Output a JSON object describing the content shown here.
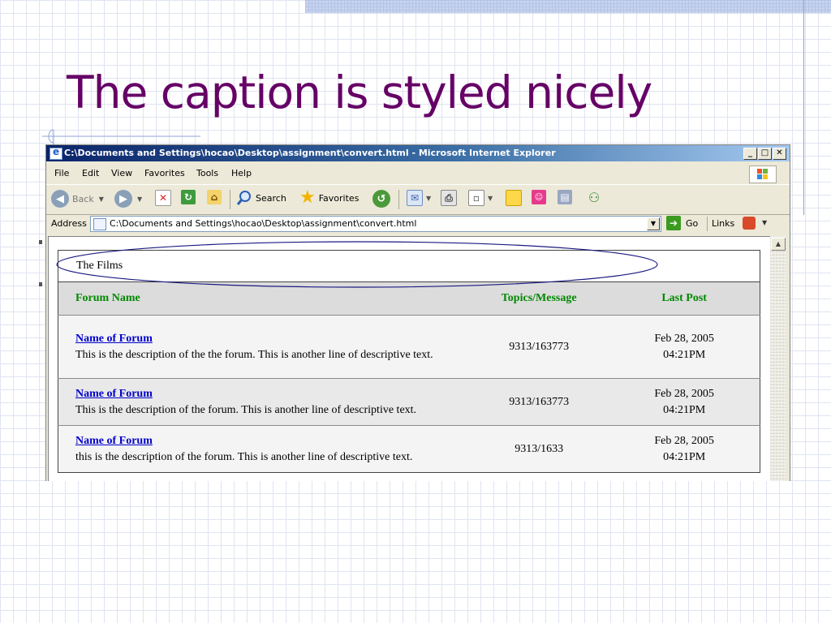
{
  "slide": {
    "title": "The caption is styled nicely"
  },
  "window": {
    "title": "C:\\Documents and Settings\\hocao\\Desktop\\assignment\\convert.html - Microsoft Internet Explorer",
    "min": "_",
    "max": "□",
    "close": "✕"
  },
  "menu": [
    "File",
    "Edit",
    "View",
    "Favorites",
    "Tools",
    "Help"
  ],
  "toolbar": {
    "back": "Back",
    "search": "Search",
    "favorites": "Favorites"
  },
  "address": {
    "label": "Address",
    "value": "C:\\Documents and Settings\\hocao\\Desktop\\assignment\\convert.html",
    "go": "Go",
    "links": "Links"
  },
  "table": {
    "caption": "The Films",
    "headers": [
      "Forum Name",
      "Topics/Message",
      "Last Post"
    ],
    "rows": [
      {
        "name": "Name of Forum",
        "desc": "This is the description of the the forum. This is another line of descriptive text.",
        "topics": "9313/163773",
        "date": "Feb 28, 2005",
        "time": "04:21PM"
      },
      {
        "name": "Name of Forum",
        "desc": "This is the description of the forum. This is another line of descriptive text.",
        "topics": "9313/163773",
        "date": "Feb 28, 2005",
        "time": "04:21PM"
      },
      {
        "name": "Name of Forum",
        "desc": "this is the description of the forum. This is another line of descriptive text.",
        "topics": "9313/1633",
        "date": "Feb 28, 2005",
        "time": "04:21PM"
      }
    ]
  },
  "colors": {
    "title": "#660066",
    "header_text": "#008800",
    "link": "#0000cc",
    "annotation": "#1a1a80"
  }
}
